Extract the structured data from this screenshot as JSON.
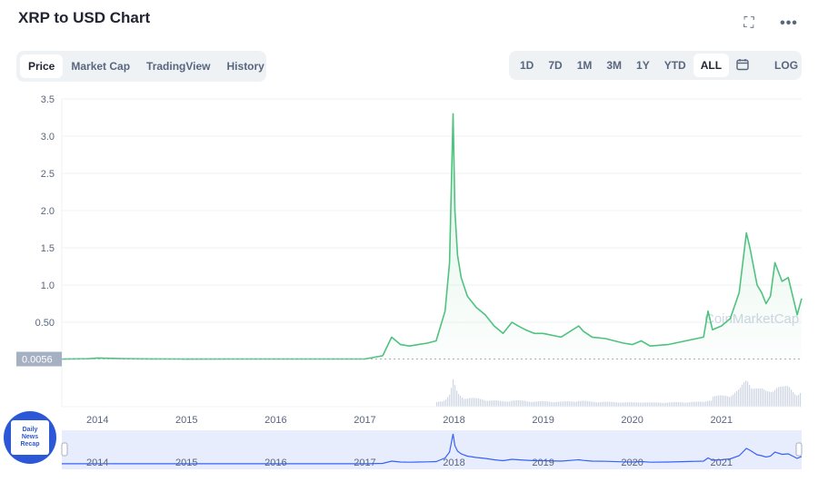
{
  "header": {
    "title": "XRP to USD Chart"
  },
  "icons": {
    "fullscreen": "fullscreen-icon",
    "more": "more-icon",
    "calendar": "calendar-icon"
  },
  "tabs": [
    {
      "label": "Price",
      "active": true
    },
    {
      "label": "Market Cap",
      "active": false
    },
    {
      "label": "TradingView",
      "active": false
    },
    {
      "label": "History",
      "active": false
    }
  ],
  "ranges": [
    {
      "label": "1D",
      "active": false
    },
    {
      "label": "7D",
      "active": false
    },
    {
      "label": "1M",
      "active": false
    },
    {
      "label": "3M",
      "active": false
    },
    {
      "label": "1Y",
      "active": false
    },
    {
      "label": "YTD",
      "active": false
    },
    {
      "label": "ALL",
      "active": true
    }
  ],
  "log_label": "LOG",
  "watermark": "CoinMarketCap",
  "badge": {
    "text": [
      "Daily",
      "News",
      "Recap"
    ]
  },
  "colors": {
    "line": "#4fc27f",
    "navigator": "#3861fb",
    "volume": "#cfd6e4",
    "badge": "#2c58d8"
  },
  "chart_data": {
    "type": "line",
    "title": "XRP to USD Chart",
    "xlabel": "",
    "ylabel": "",
    "ylim": [
      0,
      3.5
    ],
    "y_ticks": [
      "0.50",
      "1.0",
      "1.5",
      "2.0",
      "2.5",
      "3.0",
      "3.5"
    ],
    "y_tick_values": [
      0.5,
      1.0,
      1.5,
      2.0,
      2.5,
      3.0,
      3.5
    ],
    "x_ticks": [
      "2014",
      "2015",
      "2016",
      "2017",
      "2018",
      "2019",
      "2020",
      "2021"
    ],
    "xlim": [
      2013.6,
      2021.9
    ],
    "current_price_label": "0.0056",
    "current_price_value": 0.0056,
    "series": [
      {
        "x": [
          2013.6,
          2013.9,
          2014.0,
          2014.3,
          2014.6,
          2014.9,
          2015.0,
          2015.5,
          2016.0,
          2016.5,
          2017.0,
          2017.2,
          2017.3,
          2017.35,
          2017.4,
          2017.5,
          2017.6,
          2017.7,
          2017.8,
          2017.9,
          2017.95,
          2017.99,
          2018.01,
          2018.04,
          2018.08,
          2018.15,
          2018.25,
          2018.35,
          2018.45,
          2018.55,
          2018.65,
          2018.72,
          2018.8,
          2018.9,
          2019.0,
          2019.2,
          2019.4,
          2019.45,
          2019.55,
          2019.7,
          2019.9,
          2020.0,
          2020.1,
          2020.2,
          2020.4,
          2020.6,
          2020.8,
          2020.85,
          2020.9,
          2021.0,
          2021.1,
          2021.2,
          2021.28,
          2021.32,
          2021.4,
          2021.45,
          2021.5,
          2021.55,
          2021.6,
          2021.68,
          2021.75,
          2021.8,
          2021.85,
          2021.9
        ],
        "y": [
          0.005,
          0.01,
          0.02,
          0.01,
          0.007,
          0.006,
          0.005,
          0.006,
          0.006,
          0.006,
          0.006,
          0.05,
          0.3,
          0.25,
          0.2,
          0.18,
          0.2,
          0.22,
          0.25,
          0.65,
          1.3,
          3.3,
          2.0,
          1.4,
          1.1,
          0.85,
          0.7,
          0.6,
          0.45,
          0.35,
          0.5,
          0.45,
          0.4,
          0.35,
          0.35,
          0.3,
          0.45,
          0.38,
          0.3,
          0.28,
          0.22,
          0.2,
          0.25,
          0.18,
          0.2,
          0.25,
          0.3,
          0.65,
          0.4,
          0.45,
          0.55,
          0.9,
          1.7,
          1.5,
          1.0,
          0.9,
          0.75,
          0.85,
          1.3,
          1.05,
          1.1,
          0.85,
          0.6,
          0.82
        ]
      }
    ]
  }
}
